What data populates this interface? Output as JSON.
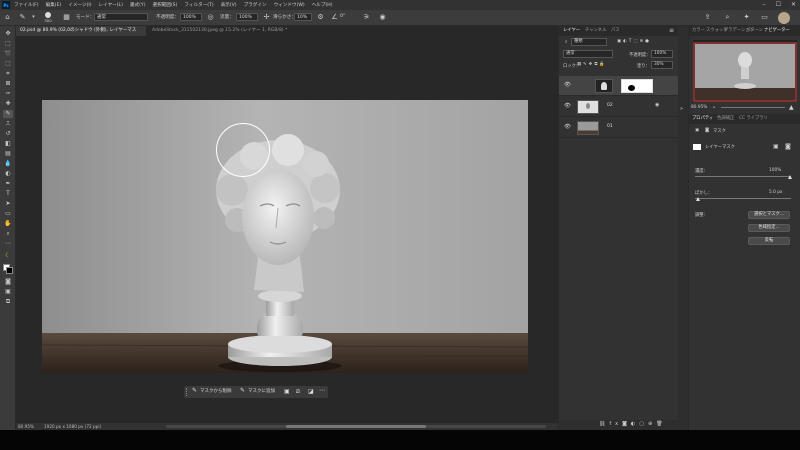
{
  "menu": {
    "logo": "Ps",
    "items": [
      "ファイル(F)",
      "編集(E)",
      "イメージ(I)",
      "レイヤー(L)",
      "書式(Y)",
      "選択範囲(S)",
      "フィルター(T)",
      "表示(V)",
      "プラグイン",
      "ウィンドウ(W)",
      "ヘルプ(H)"
    ]
  },
  "options": {
    "brush_size": "300",
    "mode_label": "モード：",
    "mode_value": "通常",
    "opacity_label": "不透明度：",
    "opacity_value": "100%",
    "flow_label": "流量：",
    "flow_value": "100%",
    "smoothing_label": "滑らかさ：",
    "smoothing_value": "10%",
    "angle_value": "0°"
  },
  "tabs": [
    {
      "label": "02.psd @ 80.9% (02,0のシャドウ (外側), レイヤーマスク/8) *",
      "active": true
    },
    {
      "label": "AdobeStock_311502130.jpeg @ 15.2% (レイヤー 1, RGB/8) *",
      "active": false
    }
  ],
  "taskbar": {
    "subtract": "マスクから削除",
    "add": "マスクに追加"
  },
  "status": {
    "zoom": "80.95%",
    "doc_size": "1920 px x 1080 px (72 ppi)"
  },
  "layers_panel": {
    "tabs": [
      "レイヤー",
      "チャンネル",
      "パス"
    ],
    "search_kind": "種類",
    "blend_mode": "通常",
    "opacity_label": "不透明度：",
    "opacity_value": "100%",
    "lock_label": "ロック：",
    "fill_label": "塗り：",
    "fill_value": "30%",
    "layers": [
      {
        "name": "",
        "selected": true
      },
      {
        "name": "02",
        "selected": false
      },
      {
        "name": "01",
        "selected": false
      }
    ]
  },
  "right_tabs": [
    "カラー",
    "スウォッチ",
    "グラデーション",
    "パターン",
    "ナビゲーター"
  ],
  "navigator_zoom": "80.95%",
  "props_tabs": [
    "プロパティ",
    "色調補正",
    "CC ライブラリ"
  ],
  "props": {
    "section": "マスク",
    "mask_label": "レイヤーマスク",
    "density_label": "濃度：",
    "density_value": "100%",
    "feather_label": "ぼかし：",
    "feather_value": "5.0 px",
    "refine_label": "調整：",
    "btn_select_mask": "選択とマスク...",
    "btn_color_range": "色域指定...",
    "btn_invert": "反転"
  },
  "colors": {
    "accent": "#31a8ff",
    "nav_box": "#e03c3c"
  }
}
